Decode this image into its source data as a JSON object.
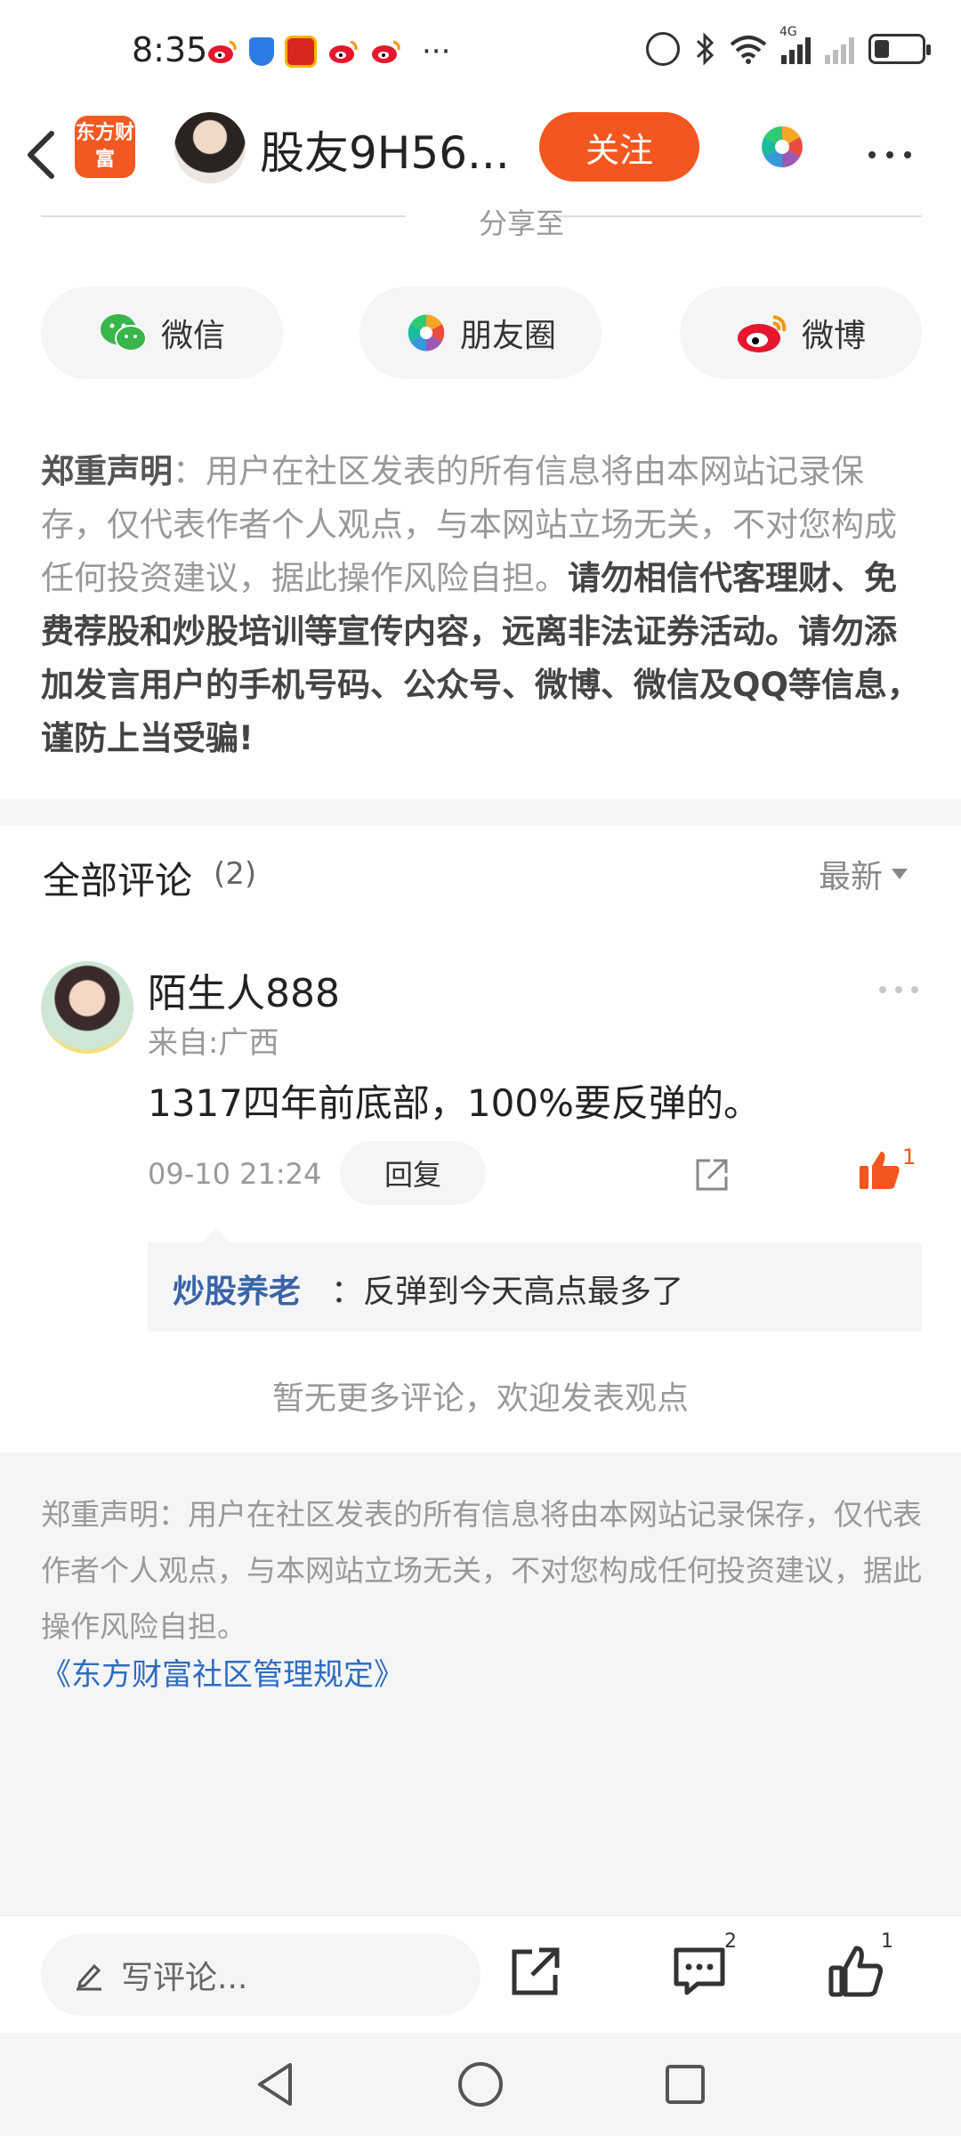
{
  "status_bar": {
    "time": "8:35",
    "more": "···",
    "network_label": "4G",
    "battery_level": 0.3
  },
  "header": {
    "brand_logo_text": "东方财富",
    "username": "股友9H56...",
    "follow_label": "关注"
  },
  "share": {
    "title": "分享至",
    "buttons": [
      {
        "label": "微信",
        "icon": "wechat-icon"
      },
      {
        "label": "朋友圈",
        "icon": "moments-icon"
      },
      {
        "label": "微博",
        "icon": "weibo-icon"
      }
    ]
  },
  "disclaimer": {
    "heading": "郑重声明",
    "body": "：用户在社区发表的所有信息将由本网站记录保存，仅代表作者个人观点，与本网站立场无关，不对您构成任何投资建议，据此操作风险自担。",
    "warning": "请勿相信代客理财、免费荐股和炒股培训等宣传内容，远离非法证券活动。请勿添加发言用户的手机号码、公众号、微博、微信及QQ等信息，谨防上当受骗!"
  },
  "comments": {
    "title": "全部评论",
    "count": "(2)",
    "sort_label": "最新",
    "items": [
      {
        "user": "陌生人888",
        "from": "来自:广西",
        "text": "1317四年前底部，100%要反弹的。",
        "time": "09-10 21:24",
        "reply_label": "回复",
        "likes": "1",
        "replies": [
          {
            "user": "炒股养老",
            "text": "：反弹到今天高点最多了"
          }
        ]
      }
    ],
    "no_more": "暂无更多评论，欢迎发表观点"
  },
  "footer": {
    "notice": "郑重声明：用户在社区发表的所有信息将由本网站记录保存，仅代表作者个人观点，与本网站立场无关，不对您构成任何投资建议，据此操作风险自担。",
    "rules_link": "《东方财富社区管理规定》"
  },
  "action_bar": {
    "comment_placeholder": "写评论...",
    "comment_count": "2",
    "like_count": "1"
  },
  "colors": {
    "accent": "#f3561f",
    "link": "#2d6cc0",
    "reply_user": "#3a64a8"
  }
}
